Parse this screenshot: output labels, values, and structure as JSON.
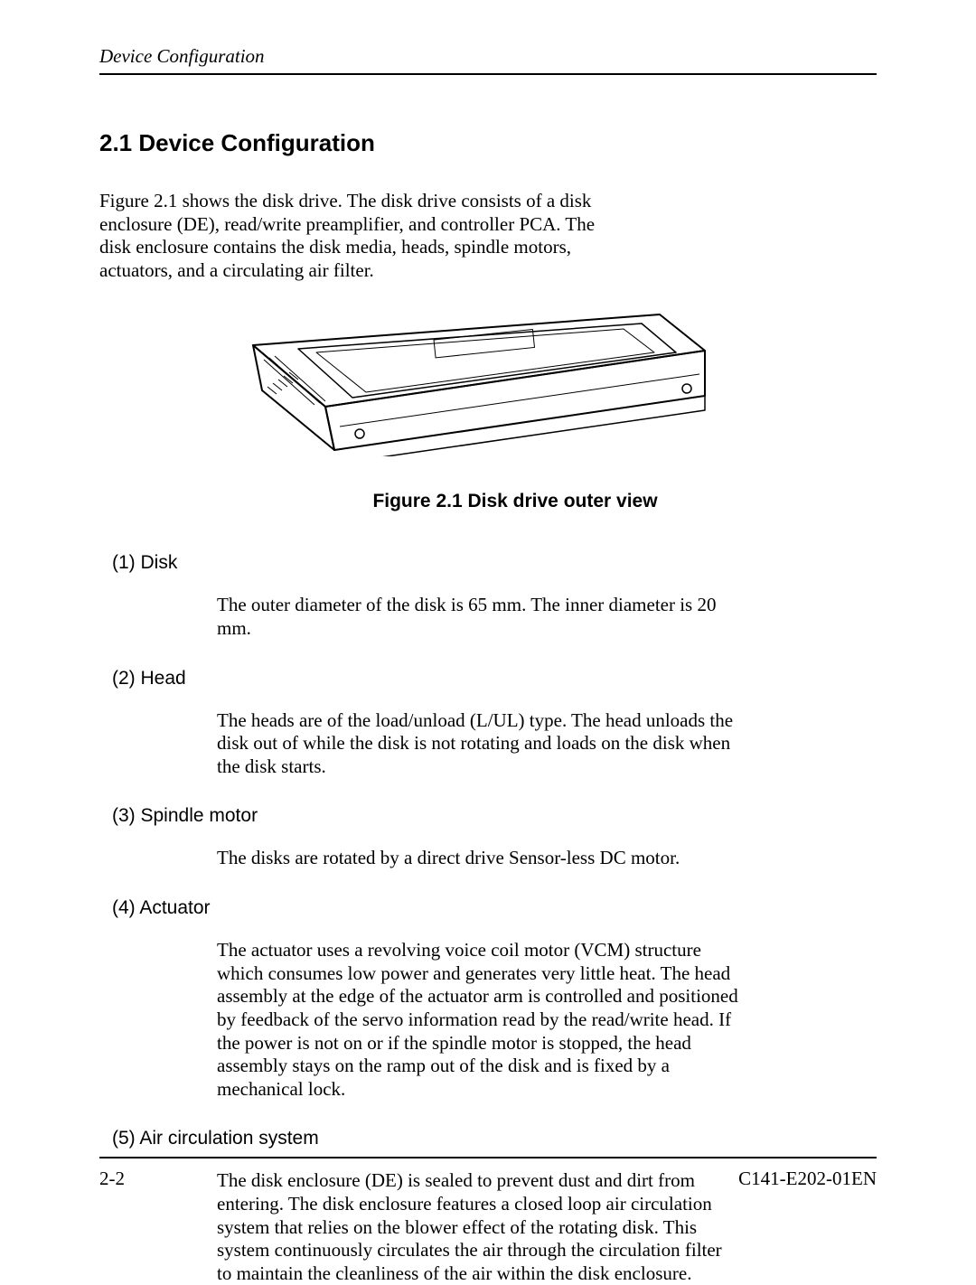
{
  "running_head": "Device Configuration",
  "section_title": "2.1  Device Configuration",
  "intro_para": "Figure 2.1 shows the disk drive.  The disk drive consists of a disk enclosure (DE), read/write preamplifier, and controller PCA.  The disk enclosure contains the disk media, heads, spindle motors, actuators, and a circulating air filter.",
  "figure_caption": "Figure 2.1  Disk drive outer view",
  "items": [
    {
      "heading": "(1)  Disk",
      "para": "The outer diameter of the disk is 65 mm.  The inner diameter is 20 mm."
    },
    {
      "heading": "(2)  Head",
      "para": "The heads are of the load/unload (L/UL) type.  The head unloads the disk out of while the disk is not rotating and loads on the disk when the disk starts."
    },
    {
      "heading": "(3)  Spindle motor",
      "para": "The disks are rotated by a direct drive Sensor-less DC motor."
    },
    {
      "heading": "(4)  Actuator",
      "para": "The actuator uses a revolving voice coil motor (VCM) structure which consumes low power and generates very little heat.  The head assembly at the edge of the actuator arm is controlled and positioned by feedback of the servo information read by the read/write head.  If the power is not on or if the spindle motor is stopped, the head assembly stays on the ramp out of the disk and is fixed by a mechanical lock."
    },
    {
      "heading": "(5)  Air circulation system",
      "para": "The disk enclosure (DE) is sealed to prevent dust and dirt from entering.  The disk enclosure features a closed loop air circulation system that relies on the blower effect of the rotating disk.  This system continuously circulates the air through the circulation filter to maintain the cleanliness of the air within the disk enclosure."
    }
  ],
  "footer_left": "2-2",
  "footer_right": "C141-E202-01EN"
}
